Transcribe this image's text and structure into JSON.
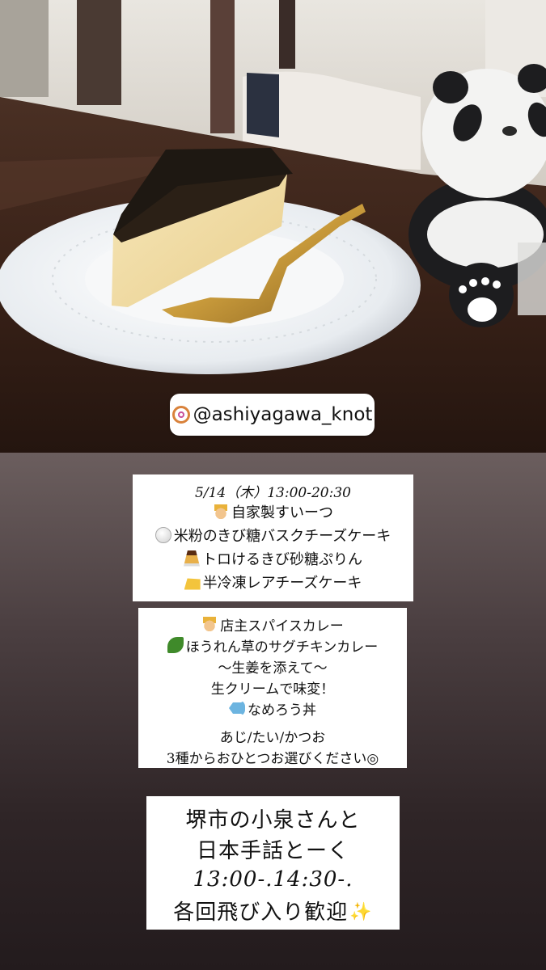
{
  "photo": {
    "description_icon": "cheesecake-photo",
    "mention": "@ashiyagawa_knot"
  },
  "menu": {
    "date": "5/14（木）13:00-20:30",
    "sweets_header": "自家製すいーつ",
    "sweets": [
      {
        "icon": "white-circle",
        "label": "米粉のきび糖バスクチーズケーキ"
      },
      {
        "icon": "pudding",
        "label": "トロけるきび砂糖ぷりん"
      },
      {
        "icon": "cheese",
        "label": "半冷凍レアチーズケーキ"
      }
    ]
  },
  "curry": {
    "header": "店主スパイスカレー",
    "item1": "ほうれん草のサグチキンカレー",
    "item1_note1": "〜生姜を添えて〜",
    "item1_note2": "生クリームで味変！",
    "item2": "なめろう丼",
    "item2_note1": "あじ/たい/かつお",
    "item2_note2": "3種からおひとつお選びください◎"
  },
  "event": {
    "line1": "堺市の小泉さんと",
    "line2": "日本手話とーく",
    "time": "13:00-.14:30-.",
    "line4": "各回飛び入り歓迎"
  },
  "colors": {
    "background_top": "#6b5e5e",
    "background_bottom": "#231b1d",
    "card": "#ffffff"
  }
}
